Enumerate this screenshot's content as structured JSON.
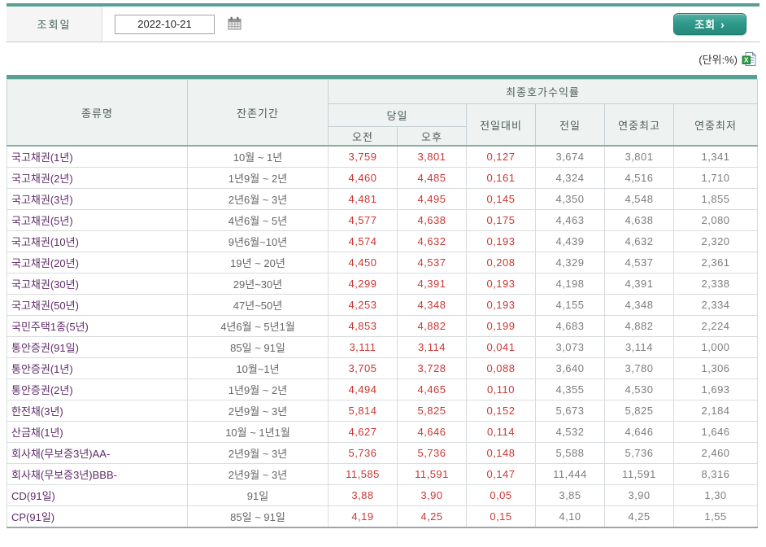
{
  "toolbar": {
    "date_label": "조회일",
    "date_value": "2022-10-21",
    "search_label": "조회",
    "search_arrow": "›"
  },
  "unit_note": "(단위:%)",
  "icons": {
    "calendar": "calendar-icon",
    "excel": "excel-download-icon"
  },
  "colors": {
    "accent_teal": "#2E9A8C",
    "border_teal": "#58A094",
    "name_purple": "#5E2B69",
    "value_red": "#CC3733",
    "value_gray": "#7D7D7D",
    "header_bg": "#EEF2F0"
  },
  "table": {
    "headers": {
      "type": "종류명",
      "period": "잔존기간",
      "yield_group": "최종호가수익률",
      "today": "당일",
      "am": "오전",
      "pm": "오후",
      "change": "전일대비",
      "prev_day": "전일",
      "year_high": "연중최고",
      "year_low": "연중최저"
    },
    "rows": [
      {
        "name": "국고채권(1년)",
        "period": "10월 ~ 1년",
        "am": "3,759",
        "pm": "3,801",
        "change": "0,127",
        "prev_day": "3,674",
        "year_high": "3,801",
        "year_low": "1,341"
      },
      {
        "name": "국고채권(2년)",
        "period": "1년9월 ~ 2년",
        "am": "4,460",
        "pm": "4,485",
        "change": "0,161",
        "prev_day": "4,324",
        "year_high": "4,516",
        "year_low": "1,710"
      },
      {
        "name": "국고채권(3년)",
        "period": "2년6월 ~ 3년",
        "am": "4,481",
        "pm": "4,495",
        "change": "0,145",
        "prev_day": "4,350",
        "year_high": "4,548",
        "year_low": "1,855"
      },
      {
        "name": "국고채권(5년)",
        "period": "4년6월 ~ 5년",
        "am": "4,577",
        "pm": "4,638",
        "change": "0,175",
        "prev_day": "4,463",
        "year_high": "4,638",
        "year_low": "2,080"
      },
      {
        "name": "국고채권(10년)",
        "period": "9년6월~10년",
        "am": "4,574",
        "pm": "4,632",
        "change": "0,193",
        "prev_day": "4,439",
        "year_high": "4,632",
        "year_low": "2,320"
      },
      {
        "name": "국고채권(20년)",
        "period": "19년 ~ 20년",
        "am": "4,450",
        "pm": "4,537",
        "change": "0,208",
        "prev_day": "4,329",
        "year_high": "4,537",
        "year_low": "2,361"
      },
      {
        "name": "국고채권(30년)",
        "period": "29년~30년",
        "am": "4,299",
        "pm": "4,391",
        "change": "0,193",
        "prev_day": "4,198",
        "year_high": "4,391",
        "year_low": "2,338"
      },
      {
        "name": "국고채권(50년)",
        "period": "47년~50년",
        "am": "4,253",
        "pm": "4,348",
        "change": "0,193",
        "prev_day": "4,155",
        "year_high": "4,348",
        "year_low": "2,334"
      },
      {
        "name": "국민주택1종(5년)",
        "period": "4년6월 ~ 5년1월",
        "am": "4,853",
        "pm": "4,882",
        "change": "0,199",
        "prev_day": "4,683",
        "year_high": "4,882",
        "year_low": "2,224"
      },
      {
        "name": "통안증권(91일)",
        "period": "85일 ~ 91일",
        "am": "3,111",
        "pm": "3,114",
        "change": "0,041",
        "prev_day": "3,073",
        "year_high": "3,114",
        "year_low": "1,000"
      },
      {
        "name": "통안증권(1년)",
        "period": "10월~1년",
        "am": "3,705",
        "pm": "3,728",
        "change": "0,088",
        "prev_day": "3,640",
        "year_high": "3,780",
        "year_low": "1,306"
      },
      {
        "name": "통안증권(2년)",
        "period": "1년9월 ~ 2년",
        "am": "4,494",
        "pm": "4,465",
        "change": "0,110",
        "prev_day": "4,355",
        "year_high": "4,530",
        "year_low": "1,693"
      },
      {
        "name": "한전채(3년)",
        "period": "2년9월 ~ 3년",
        "am": "5,814",
        "pm": "5,825",
        "change": "0,152",
        "prev_day": "5,673",
        "year_high": "5,825",
        "year_low": "2,184"
      },
      {
        "name": "산금채(1년)",
        "period": "10월 ~ 1년1월",
        "am": "4,627",
        "pm": "4,646",
        "change": "0,114",
        "prev_day": "4,532",
        "year_high": "4,646",
        "year_low": "1,646"
      },
      {
        "name": "회사채(무보증3년)AA-",
        "period": "2년9월 ~ 3년",
        "am": "5,736",
        "pm": "5,736",
        "change": "0,148",
        "prev_day": "5,588",
        "year_high": "5,736",
        "year_low": "2,460"
      },
      {
        "name": "회사채(무보증3년)BBB-",
        "period": "2년9월 ~ 3년",
        "am": "11,585",
        "pm": "11,591",
        "change": "0,147",
        "prev_day": "11,444",
        "year_high": "11,591",
        "year_low": "8,316"
      },
      {
        "name": "CD(91일)",
        "period": "91일",
        "am": "3,88",
        "pm": "3,90",
        "change": "0,05",
        "prev_day": "3,85",
        "year_high": "3,90",
        "year_low": "1,30"
      },
      {
        "name": "CP(91일)",
        "period": "85일 ~ 91일",
        "am": "4,19",
        "pm": "4,25",
        "change": "0,15",
        "prev_day": "4,10",
        "year_high": "4,25",
        "year_low": "1,55"
      }
    ]
  }
}
